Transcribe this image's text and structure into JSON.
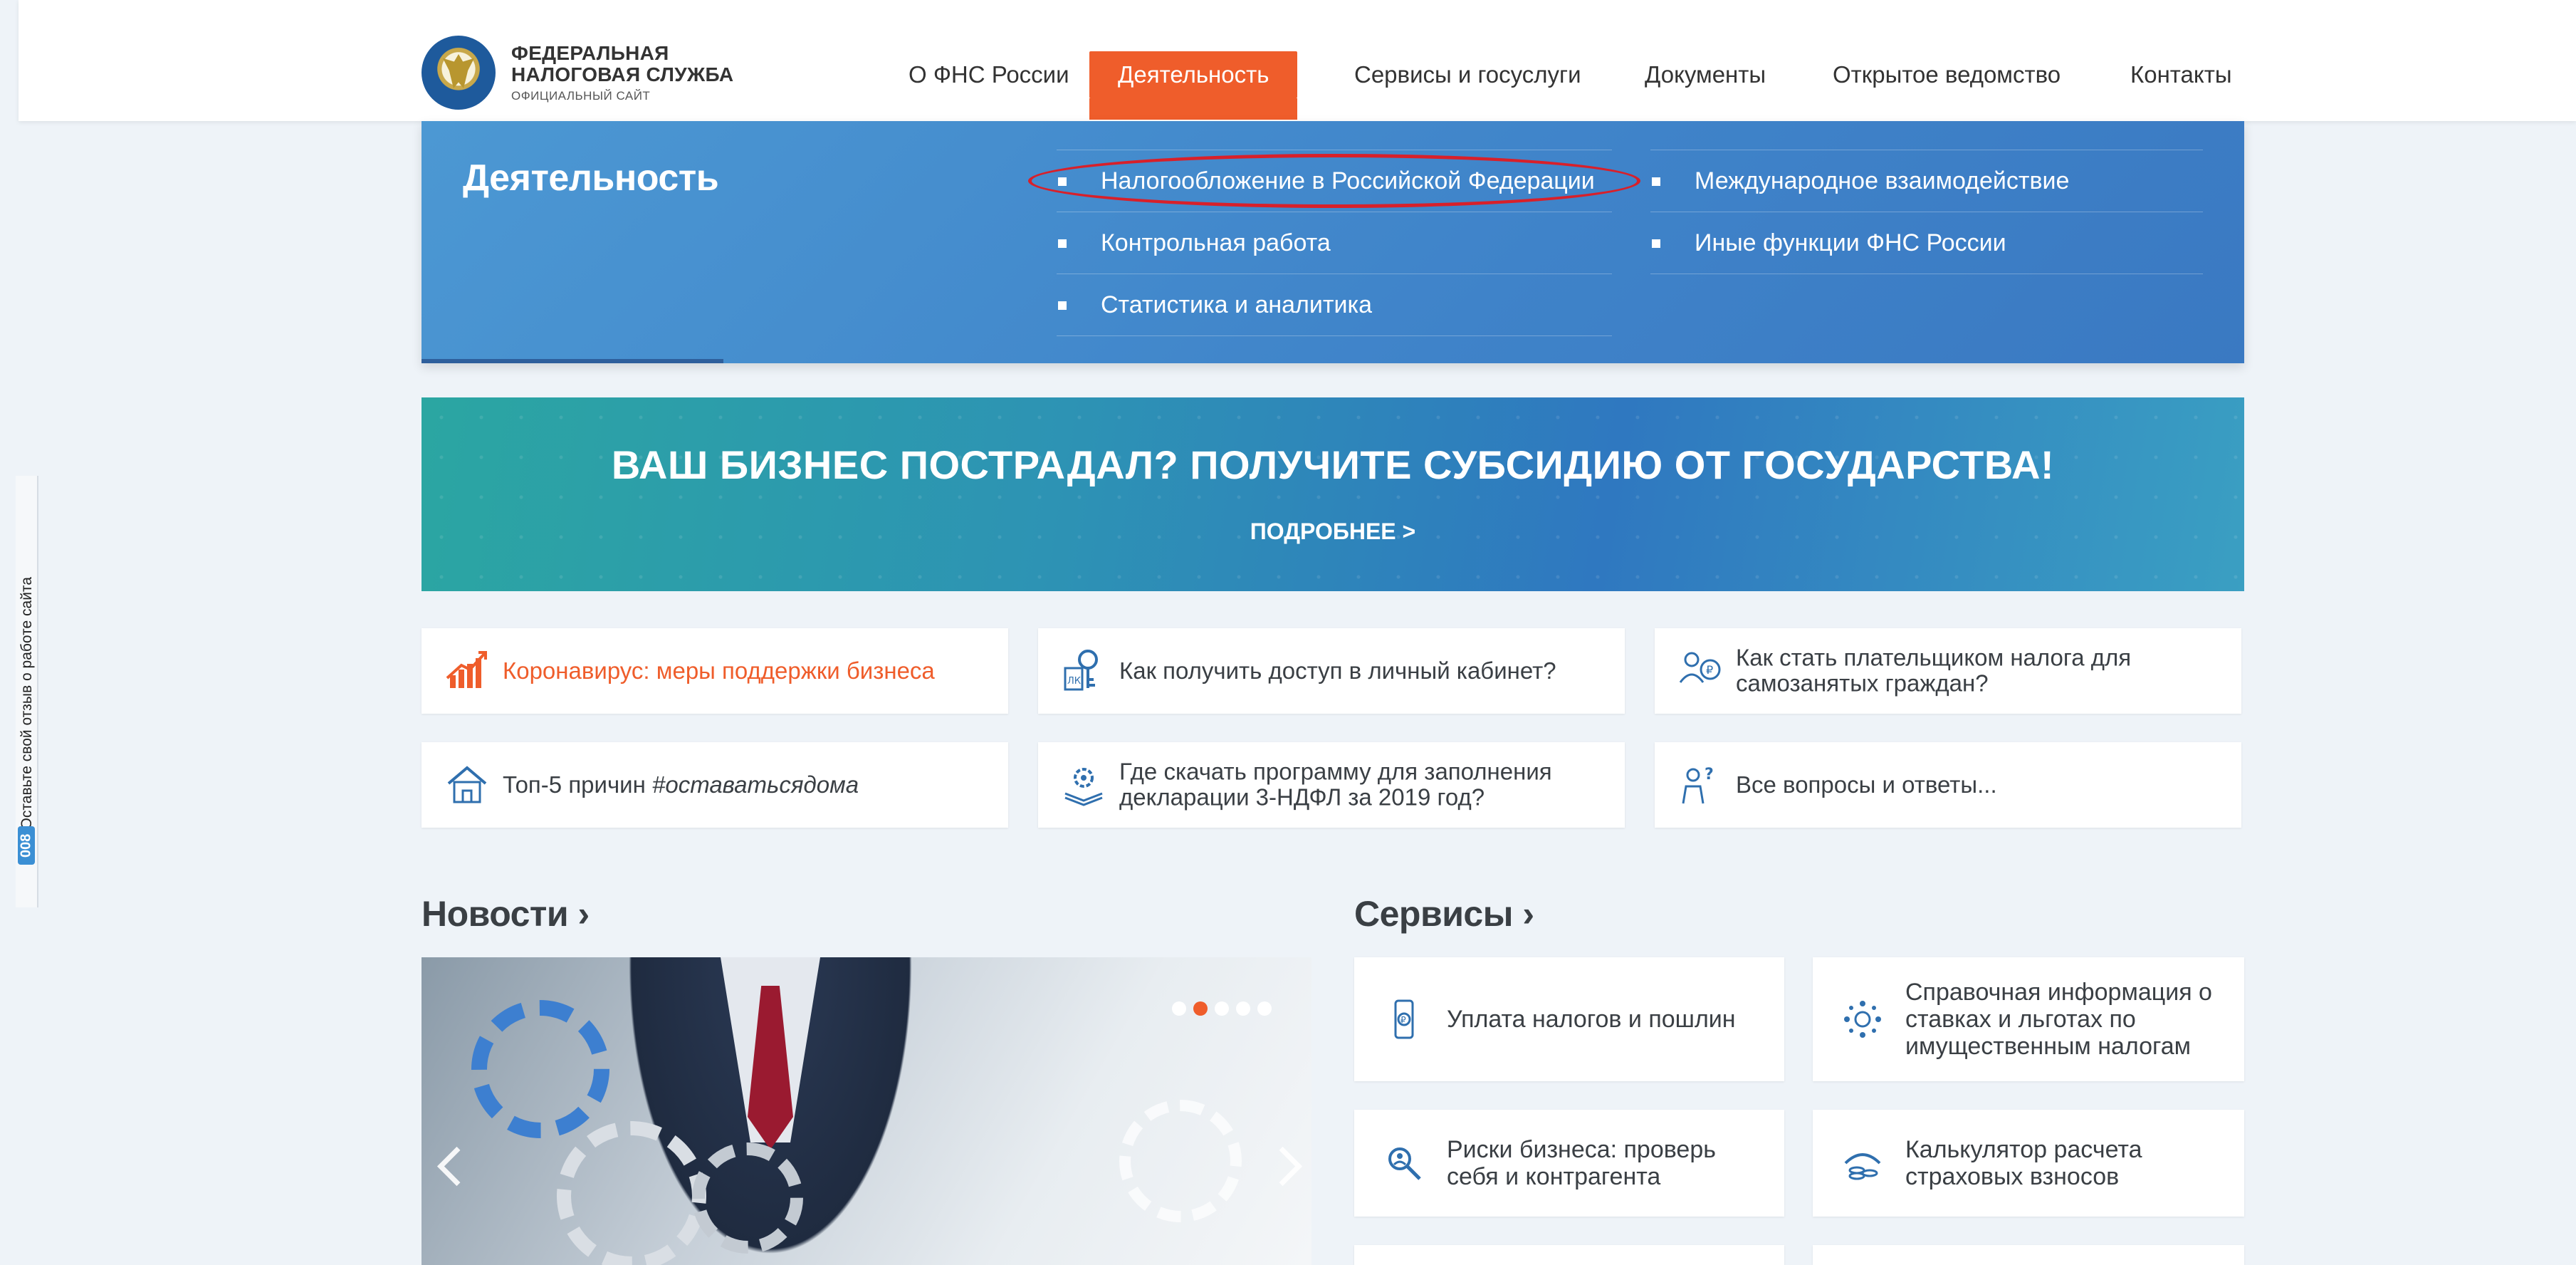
{
  "feedback": {
    "text": "Оставьте свой отзыв о работе сайта",
    "badge": "008"
  },
  "logo": {
    "line1": "ФЕДЕРАЛЬНАЯ",
    "line2": "НАЛОГОВАЯ СЛУЖБА",
    "sub": "ОФИЦИАЛЬНЫЙ САЙТ"
  },
  "nav": [
    {
      "label": "О ФНС России"
    },
    {
      "label": "Деятельность",
      "active": true
    },
    {
      "label": "Сервисы и госуслуги"
    },
    {
      "label": "Документы"
    },
    {
      "label": "Открытое ведомство"
    },
    {
      "label": "Контакты"
    }
  ],
  "panel": {
    "title": "Деятельность",
    "col1": [
      {
        "label": "Налогообложение в Российской Федерации",
        "highlighted": true
      },
      {
        "label": "Контрольная работа"
      },
      {
        "label": "Статистика и аналитика"
      }
    ],
    "col2": [
      {
        "label": "Международное взаимодействие"
      },
      {
        "label": "Иные функции ФНС России"
      }
    ]
  },
  "banner": {
    "title": "ВАШ БИЗНЕС ПОСТРАДАЛ? ПОЛУЧИТЕ СУБСИДИЮ ОТ ГОСУДАРСТВА!",
    "link": "ПОДРОБНЕЕ >"
  },
  "cards": [
    {
      "label": "Коронавирус: меры поддержки бизнеса",
      "icon": "chart-growth-icon",
      "highlight": true
    },
    {
      "label": "Как получить доступ в личный кабинет?",
      "icon": "key-account-icon"
    },
    {
      "label": "Как стать плательщиком налога для самозанятых граждан?",
      "icon": "self-employed-icon"
    },
    {
      "label": "Топ-5 причин #оставатьсядома",
      "icon": "house-icon"
    },
    {
      "label": "Где скачать программу для заполнения декларации 3-НДФЛ за 2019 год?",
      "icon": "gear-download-icon"
    },
    {
      "label": "Все вопросы и ответы...",
      "icon": "questions-icon"
    }
  ],
  "news": {
    "title": "Новости",
    "slides_count": 5,
    "active_slide": 2
  },
  "services": {
    "title": "Сервисы",
    "items": [
      {
        "label": "Уплата налогов и пошлин",
        "icon": "phone-ruble-icon"
      },
      {
        "label": "Справочная информация о ставках и льготах по имущественным налогам",
        "icon": "info-network-icon"
      },
      {
        "label": "Риски бизнеса: проверь себя и контрагента",
        "icon": "search-business-icon"
      },
      {
        "label": "Калькулятор расчета страховых взносов",
        "icon": "coins-umbrella-icon"
      }
    ]
  },
  "colors": {
    "accent": "#ef5d2b",
    "panel_blue": "#4189cb",
    "text": "#3a3f44",
    "highlight_oval": "#d8202a"
  }
}
